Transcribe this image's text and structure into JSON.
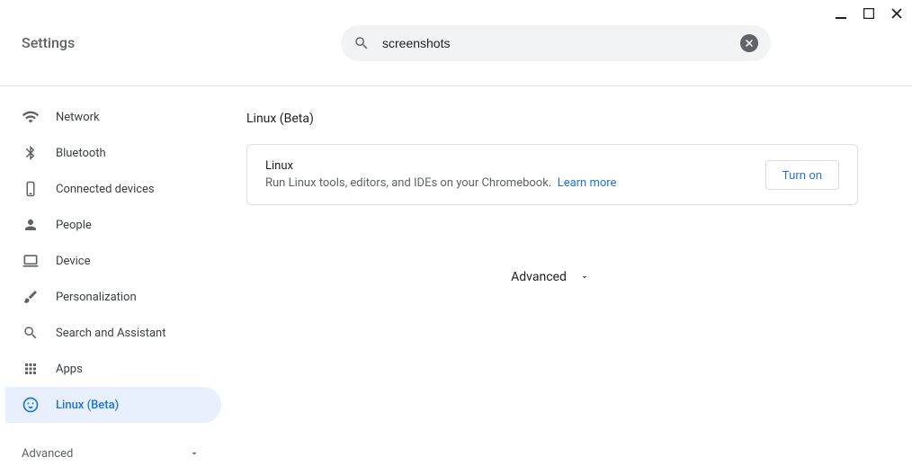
{
  "window": {},
  "header": {
    "title": "Settings"
  },
  "search": {
    "value": "screenshots"
  },
  "sidebar": {
    "items": [
      {
        "label": "Network"
      },
      {
        "label": "Bluetooth"
      },
      {
        "label": "Connected devices"
      },
      {
        "label": "People"
      },
      {
        "label": "Device"
      },
      {
        "label": "Personalization"
      },
      {
        "label": "Search and Assistant"
      },
      {
        "label": "Apps"
      },
      {
        "label": "Linux (Beta)"
      }
    ],
    "advanced_label": "Advanced"
  },
  "main": {
    "section_title": "Linux (Beta)",
    "card": {
      "title": "Linux",
      "description": "Run Linux tools, editors, and IDEs on your Chromebook.",
      "learn_more": "Learn more",
      "action_label": "Turn on"
    },
    "advanced_label": "Advanced"
  }
}
